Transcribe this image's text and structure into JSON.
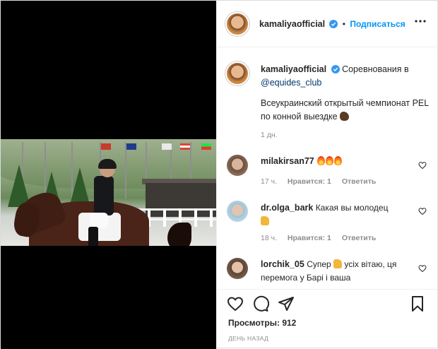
{
  "header": {
    "username": "kamaliyaofficial",
    "follow_label": "Подписаться",
    "separator": "•"
  },
  "caption": {
    "username": "kamaliyaofficial",
    "text_before_mention": "Соревнования в",
    "mention": "@equides_club",
    "body": "Всеукраинский открытый чемпионат PEL по конной выездке",
    "time": "1 дн."
  },
  "comments": [
    {
      "username": "milakirsan77",
      "text": "",
      "time": "17 ч.",
      "likes": "Нравится: 1",
      "reply": "Ответить"
    },
    {
      "username": "dr.olga_bark",
      "text": "Какая вы молодец",
      "time": "18 ч.",
      "likes": "Нравится: 1",
      "reply": "Ответить"
    },
    {
      "username": "lorchik_05",
      "text_before_emoji": "Супер",
      "text_after_emoji": "усіх вітаю, ця перемога у Барі і ваша"
    }
  ],
  "footer": {
    "views_label": "Просмотры: 912",
    "posted_label": "ДЕНЬ НАЗАД"
  },
  "icons": {
    "verified": "verified-badge-icon",
    "more": "more-options-icon",
    "like": "heart-icon",
    "comment": "comment-bubble-icon",
    "share": "paper-plane-icon",
    "save": "bookmark-icon"
  },
  "colors": {
    "link_blue": "#0095f6",
    "mention_blue": "#00376b",
    "muted_text": "#8e8e8e",
    "primary_text": "#262626",
    "divider": "#efefef"
  }
}
